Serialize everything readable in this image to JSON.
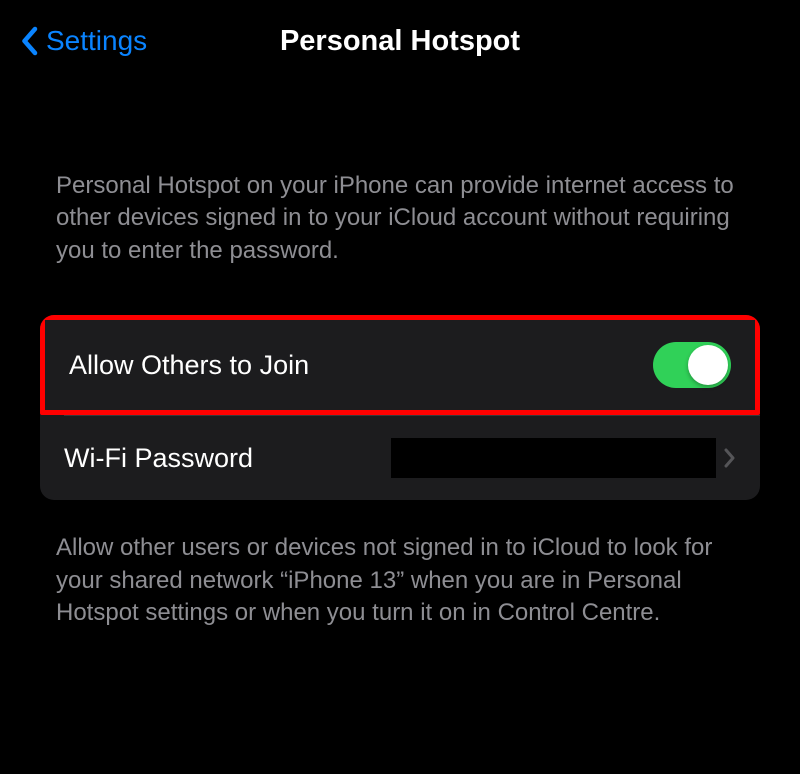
{
  "header": {
    "back_label": "Settings",
    "title": "Personal Hotspot"
  },
  "intro_text": "Personal Hotspot on your iPhone can provide internet access to other devices signed in to your iCloud account without requiring you to enter the password.",
  "rows": {
    "allow_others": {
      "label": "Allow Others to Join",
      "enabled": true
    },
    "wifi_password": {
      "label": "Wi-Fi Password"
    }
  },
  "footer_text": "Allow other users or devices not signed in to iCloud to look for your shared network “iPhone 13” when you are in Personal Hotspot settings or when you turn it on in Control Centre."
}
